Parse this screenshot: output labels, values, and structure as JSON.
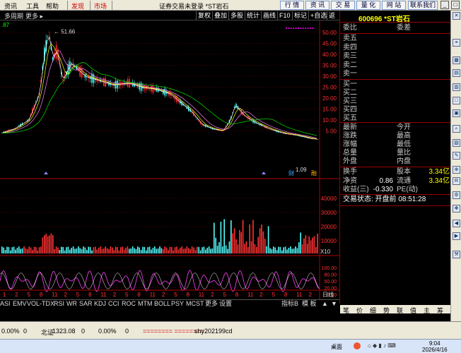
{
  "menubar": {
    "items": [
      "资讯",
      "工具",
      "帮助"
    ],
    "red_items": [
      "发现",
      "市场"
    ],
    "title": "证券交易未登录 *ST岩石",
    "right_buttons": [
      "行 情",
      "资 讯",
      "交 易",
      "量 化",
      "网 站",
      "联系我们"
    ]
  },
  "toolbar2": {
    "left": [
      "多周期",
      "更多 ▸"
    ],
    "buttons": [
      "复权",
      "叠加",
      "多股",
      "统计",
      "画线",
      "F10",
      "标记",
      "+自选",
      "返回"
    ],
    "ma_value": ".87"
  },
  "chart": {
    "peak_label": "51.66",
    "low_label": "1.09",
    "price_ticks": [
      "50.00",
      "45.00",
      "40.00",
      "35.00",
      "30.00",
      "25.00",
      "20.00",
      "15.00",
      "10.00",
      "5.00"
    ],
    "volume_ticks": [
      "40000",
      "30000",
      "20000",
      "10000"
    ],
    "volume_unit": "X10",
    "indicator_ticks": [
      "100.00",
      "80.00",
      "50.00",
      "20.00",
      "0.00"
    ],
    "xaxis_label": "日线",
    "xaxis_ticks": [
      "1",
      "2",
      "5",
      "8",
      "11",
      "2",
      "5",
      "8",
      "11",
      "2",
      "5",
      "8",
      "11",
      "2",
      "5",
      "8",
      "11",
      "2",
      "5",
      "8",
      "11",
      "2",
      "5",
      "8",
      "11",
      "2"
    ],
    "small_marks": [
      "财",
      "融"
    ]
  },
  "right_panel": {
    "code": "600696 *ST岩石",
    "order_header": [
      "委比",
      "委差"
    ],
    "sells": [
      "卖五",
      "卖四",
      "卖三",
      "卖二",
      "卖一"
    ],
    "buys": [
      "买一",
      "买二",
      "买三",
      "买四",
      "买五"
    ],
    "stats_left": [
      "最新",
      "涨跌",
      "涨幅",
      "总量",
      "外盘"
    ],
    "stats_right": [
      "今开",
      "最高",
      "最低",
      "量比",
      "内盘"
    ],
    "rows2": [
      {
        "l": "换手",
        "v1": "",
        "m": "股本",
        "v2": "3.34亿"
      },
      {
        "l": "净资",
        "v1": "0.86",
        "m": "流通",
        "v2": "3.34亿"
      },
      {
        "l": "收益(三)",
        "v1": "-0.330",
        "m": "PE(动)",
        "v2": ""
      }
    ],
    "status": "交易状态: 开盘前 08:51:28",
    "tabs": [
      "笔",
      "价",
      "细",
      "势",
      "联",
      "值",
      "主",
      "筹"
    ]
  },
  "tabbar": {
    "items": [
      "ASI",
      "EMV",
      "VOL-TDX",
      "RSI",
      "WR",
      "SAR",
      "KDJ",
      "CCI",
      "ROC",
      "MTM",
      "BOLL",
      "PSY",
      "MCST",
      "更多",
      "设置"
    ],
    "right": [
      "指标B",
      "模 板",
      "▲",
      "▼"
    ]
  },
  "statusbar": {
    "items": [
      "0.00%",
      "0",
      "北证",
      "1323.08",
      "0",
      "0.00%",
      "0"
    ],
    "marker": "======== ========",
    "account": "shy202199cd"
  },
  "taskbar": {
    "desktop": "桌面",
    "time": "9:04",
    "date": "2026/4/16"
  },
  "colors": {
    "up": "#ff3232",
    "down": "#54fcfc",
    "ma5": "#ffffff",
    "ma10": "#ffff00",
    "ma20": "#ff80ff",
    "ma60": "#00e600",
    "grid": "#b00000"
  }
}
